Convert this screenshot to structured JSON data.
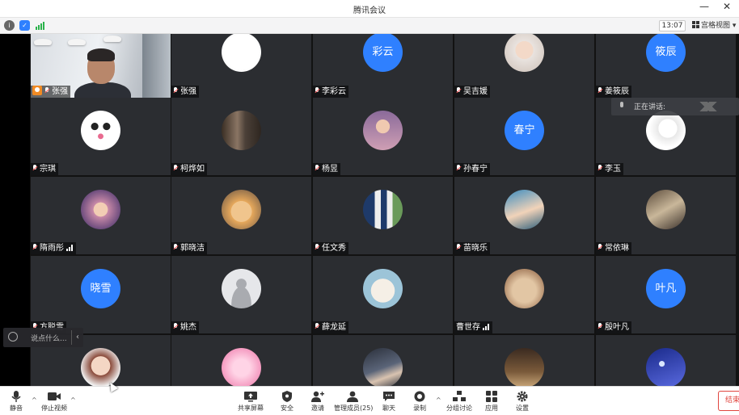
{
  "window": {
    "title": "腾讯会议",
    "min_icon": "minimize-icon",
    "close_icon": "close-icon"
  },
  "toolbar": {
    "info_icon": "info-icon",
    "shield_icon": "shield-icon",
    "signal_icon": "signal-icon",
    "time": "13:07",
    "grid_view_label": "宫格视图"
  },
  "speaking": {
    "label": "正在讲话:"
  },
  "chat": {
    "placeholder": "说点什么..."
  },
  "participants": [
    {
      "name": "张强",
      "type": "video",
      "host": true
    },
    {
      "name": "张强",
      "type": "image",
      "img": "logo-cream"
    },
    {
      "name": "李彩云",
      "type": "text",
      "avatar_text": "彩云"
    },
    {
      "name": "吴吉媛",
      "type": "image",
      "img": "girl"
    },
    {
      "name": "姜筱辰",
      "type": "text",
      "avatar_text": "筱辰"
    },
    {
      "name": "宗琪",
      "type": "image",
      "img": "panda"
    },
    {
      "name": "柯烨如",
      "type": "image",
      "img": "street"
    },
    {
      "name": "杨昱",
      "type": "image",
      "img": "boy"
    },
    {
      "name": "孙春宁",
      "type": "text",
      "avatar_text": "春宁"
    },
    {
      "name": "李玉",
      "type": "image",
      "img": "sketch"
    },
    {
      "name": "隋雨彤",
      "type": "image",
      "img": "anime",
      "signal": true
    },
    {
      "name": "郭晓洁",
      "type": "image",
      "img": "cartoon"
    },
    {
      "name": "任文秀",
      "type": "image",
      "img": "player"
    },
    {
      "name": "苗晓乐",
      "type": "image",
      "img": "portrait"
    },
    {
      "name": "常依琳",
      "type": "image",
      "img": "desk"
    },
    {
      "name": "方聪雪",
      "type": "text",
      "avatar_text": "晓雪"
    },
    {
      "name": "姚杰",
      "type": "image",
      "img": "default"
    },
    {
      "name": "薛龙延",
      "type": "image",
      "img": "bunny"
    },
    {
      "name": "曹世存",
      "type": "image",
      "img": "cat",
      "signal": true,
      "nomic": true
    },
    {
      "name": "殷叶凡",
      "type": "text",
      "avatar_text": "叶凡"
    },
    {
      "name": "",
      "type": "image",
      "img": "doll"
    },
    {
      "name": "",
      "type": "image",
      "img": "pink"
    },
    {
      "name": "",
      "type": "image",
      "img": "sleep"
    },
    {
      "name": "",
      "type": "image",
      "img": "walker"
    },
    {
      "name": "",
      "type": "image",
      "img": "night"
    }
  ],
  "bottombar": {
    "mute": "静音",
    "stop_video": "停止视频",
    "share": "共享屏幕",
    "security": "安全",
    "invite": "邀请",
    "manage": "管理成员(25)",
    "chat": "聊天",
    "record": "录制",
    "breakout": "分组讨论",
    "apps": "应用",
    "settings": "设置",
    "end": "结束"
  },
  "colors": {
    "avatar_blue": "#2f80ff",
    "tile_bg": "#2b2d31",
    "end_red": "#e0463f",
    "signal_green": "#2bb24c"
  }
}
